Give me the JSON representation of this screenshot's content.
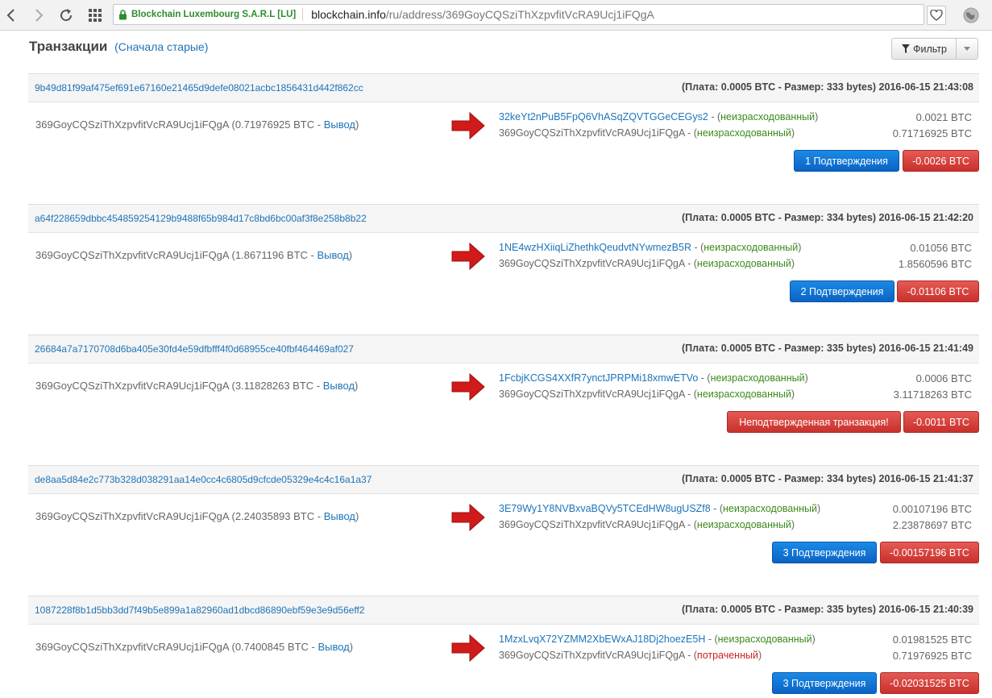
{
  "browser": {
    "ev_label": "Blockchain Luxembourg S.A.R.L [LU]",
    "url_host": "blockchain.info",
    "url_path": "/ru/address/369GoyCQSziThXzpvfitVcRA9Ucj1iFQgA"
  },
  "header": {
    "title": "Транзакции",
    "sort_link": "(Сначала старые)",
    "filter_label": "Фильтр"
  },
  "transactions": [
    {
      "hash": "9b49d81f99af475ef691e67160e21465d9defe08021acbc1856431d442f862cc",
      "meta": "(Плата: 0.0005 BTC - Размер: 333 bytes) 2016-06-15 21:43:08",
      "from_addr": "369GoyCQSziThXzpvfitVcRA9Ucj1iFQgA",
      "from_value": "(0.71976925 BTC - ",
      "from_link": "Вывод",
      "from_close": ")",
      "outputs": [
        {
          "addr": "32keYt2nPuB5FpQ6VhASqZQVTGGeCEGys2",
          "dash": " - (",
          "status": "неизрасходованный",
          "close": ")",
          "amount": "0.0021 BTC",
          "link": true,
          "spent": false
        },
        {
          "addr": "369GoyCQSziThXzpvfitVcRA9Ucj1iFQgA",
          "dash": " - (",
          "status": "неизрасходованный",
          "close": ")",
          "amount": "0.71716925 BTC",
          "link": false,
          "spent": false
        }
      ],
      "confirm_label": "1 Подтверждения",
      "confirm_color": "blue",
      "net_label": "-0.0026 BTC"
    },
    {
      "hash": "a64f228659dbbc454859254129b9488f65b984d17c8bd6bc00af3f8e258b8b22",
      "meta": "(Плата: 0.0005 BTC - Размер: 334 bytes) 2016-06-15 21:42:20",
      "from_addr": "369GoyCQSziThXzpvfitVcRA9Ucj1iFQgA",
      "from_value": "(1.8671196 BTC - ",
      "from_link": "Вывод",
      "from_close": ")",
      "outputs": [
        {
          "addr": "1NE4wzHXiiqLiZhethkQeudvtNYwmezB5R",
          "dash": " - (",
          "status": "неизрасходованный",
          "close": ")",
          "amount": "0.01056 BTC",
          "link": true,
          "spent": false
        },
        {
          "addr": "369GoyCQSziThXzpvfitVcRA9Ucj1iFQgA",
          "dash": " - (",
          "status": "неизрасходованный",
          "close": ")",
          "amount": "1.8560596 BTC",
          "link": false,
          "spent": false
        }
      ],
      "confirm_label": "2 Подтверждения",
      "confirm_color": "blue",
      "net_label": "-0.01106 BTC"
    },
    {
      "hash": "26684a7a7170708d6ba405e30fd4e59dfbfff4f0d68955ce40fbf464469af027",
      "meta": "(Плата: 0.0005 BTC - Размер: 335 bytes) 2016-06-15 21:41:49",
      "from_addr": "369GoyCQSziThXzpvfitVcRA9Ucj1iFQgA",
      "from_value": "(3.11828263 BTC - ",
      "from_link": "Вывод",
      "from_close": ")",
      "outputs": [
        {
          "addr": "1FcbjKCGS4XXfR7ynctJPRPMi18xmwETVo",
          "dash": " - (",
          "status": "неизрасходованный",
          "close": ")",
          "amount": "0.0006 BTC",
          "link": true,
          "spent": false
        },
        {
          "addr": "369GoyCQSziThXzpvfitVcRA9Ucj1iFQgA",
          "dash": " - (",
          "status": "неизрасходованный",
          "close": ")",
          "amount": "3.11718263 BTC",
          "link": false,
          "spent": false
        }
      ],
      "confirm_label": "Неподтвержденная транзакция!",
      "confirm_color": "red",
      "net_label": "-0.0011 BTC"
    },
    {
      "hash": "de8aa5d84e2c773b328d038291aa14e0cc4c6805d9cfcde05329e4c4c16a1a37",
      "meta": "(Плата: 0.0005 BTC - Размер: 334 bytes) 2016-06-15 21:41:37",
      "from_addr": "369GoyCQSziThXzpvfitVcRA9Ucj1iFQgA",
      "from_value": "(2.24035893 BTC - ",
      "from_link": "Вывод",
      "from_close": ")",
      "outputs": [
        {
          "addr": "3E79Wy1Y8NVBxvaBQVy5TCEdHW8ugUSZf8",
          "dash": " - (",
          "status": "неизрасходованный",
          "close": ")",
          "amount": "0.00107196 BTC",
          "link": true,
          "spent": false
        },
        {
          "addr": "369GoyCQSziThXzpvfitVcRA9Ucj1iFQgA",
          "dash": " - (",
          "status": "неизрасходованный",
          "close": ")",
          "amount": "2.23878697 BTC",
          "link": false,
          "spent": false
        }
      ],
      "confirm_label": "3 Подтверждения",
      "confirm_color": "blue",
      "net_label": "-0.00157196 BTC"
    },
    {
      "hash": "1087228f8b1d5bb3dd7f49b5e899a1a82960ad1dbcd86890ebf59e3e9d56eff2",
      "meta": "(Плата: 0.0005 BTC - Размер: 335 bytes) 2016-06-15 21:40:39",
      "from_addr": "369GoyCQSziThXzpvfitVcRA9Ucj1iFQgA",
      "from_value": "(0.7400845 BTC - ",
      "from_link": "Вывод",
      "from_close": ")",
      "outputs": [
        {
          "addr": "1MzxLvqX72YZMM2XbEWxAJ18Dj2hoezE5H",
          "dash": " - (",
          "status": "неизрасходованный",
          "close": ")",
          "amount": "0.01981525 BTC",
          "link": true,
          "spent": false
        },
        {
          "addr": "369GoyCQSziThXzpvfitVcRA9Ucj1iFQgA",
          "dash": " - (",
          "status": "потраченный",
          "close": ")",
          "amount": "0.71976925 BTC",
          "link": false,
          "spent": true
        }
      ],
      "confirm_label": "3 Подтверждения",
      "confirm_color": "blue",
      "net_label": "-0.02031525 BTC"
    }
  ],
  "colors": {
    "link": "#1e74b8",
    "unspent": "#3a8a1c",
    "spent": "#cc2222",
    "arrow": "#d11a1a",
    "btn_blue": "#0b63c4",
    "btn_red": "#c9302c"
  },
  "icons": {
    "back": "back-arrow-icon",
    "forward": "forward-arrow-icon",
    "reload": "reload-icon",
    "apps": "apps-grid-icon",
    "lock": "lock-icon",
    "bookmark": "heart-icon",
    "extension": "globe-icon",
    "filter": "funnel-icon",
    "dropdown": "caret-down-icon",
    "flow": "red-arrow-icon"
  }
}
